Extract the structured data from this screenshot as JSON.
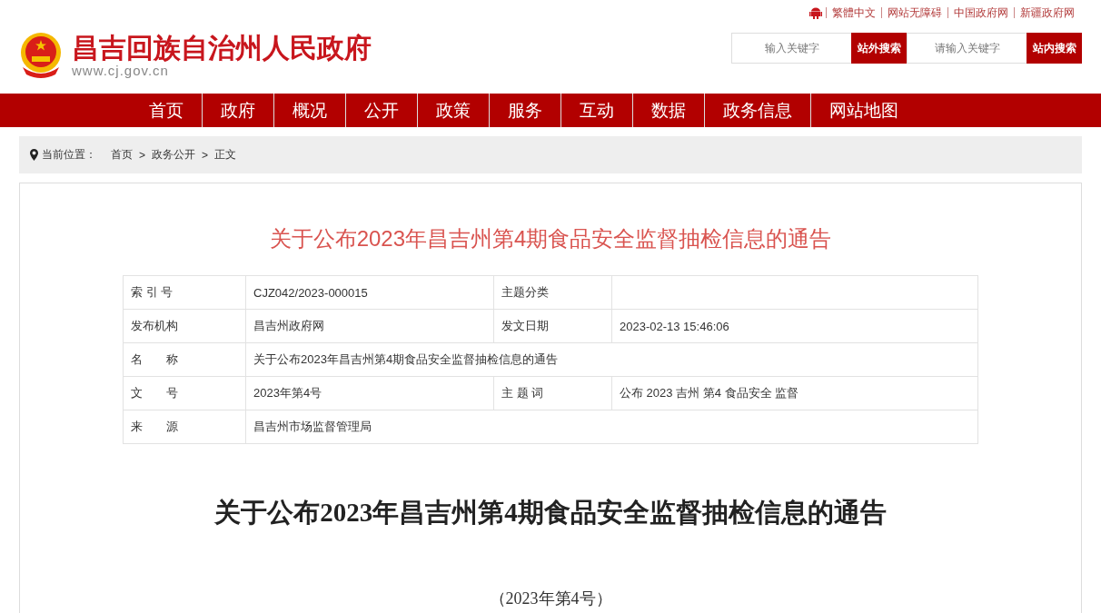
{
  "top_links": [
    "繁體中文",
    "网站无障碍",
    "中国政府网",
    "新疆政府网"
  ],
  "site": {
    "title": "昌吉回族自治州人民政府",
    "url": "www.cj.gov.cn"
  },
  "searches": [
    {
      "placeholder": "输入关键字",
      "button": "站外搜索"
    },
    {
      "placeholder": "请输入关键字",
      "button": "站内搜索"
    }
  ],
  "nav": [
    "首页",
    "政府",
    "概况",
    "公开",
    "政策",
    "服务",
    "互动",
    "数据",
    "政务信息",
    "网站地图"
  ],
  "breadcrumb": {
    "label": "当前位置：",
    "separator": ">",
    "items": [
      "首页",
      "政务公开",
      "正文"
    ]
  },
  "article": {
    "title": "关于公布2023年昌吉州第4期食品安全监督抽检信息的通告",
    "meta": [
      [
        {
          "label": "索 引 号",
          "value": "CJZ042/2023-000015"
        },
        {
          "label": "主题分类"
        }
      ],
      [
        {
          "label": "发布机构",
          "value": "昌吉州政府网"
        },
        {
          "label": "发文日期",
          "value": "2023-02-13 15:46:06"
        }
      ],
      [
        {
          "label": "名　　称",
          "value": "关于公布2023年昌吉州第4期食品安全监督抽检信息的通告"
        }
      ],
      [
        {
          "label": "文　　号",
          "value": "2023年第4号"
        },
        {
          "label": "主 题 词",
          "value": "公布 2023 吉州 第4 食品安全 监督"
        }
      ],
      [
        {
          "label": "来　　源",
          "value": "昌吉州市场监督管理局"
        }
      ]
    ],
    "heading": "关于公布2023年昌吉州第4期食品安全监督抽检信息的通告",
    "subheading": "（2023年第4号）"
  }
}
